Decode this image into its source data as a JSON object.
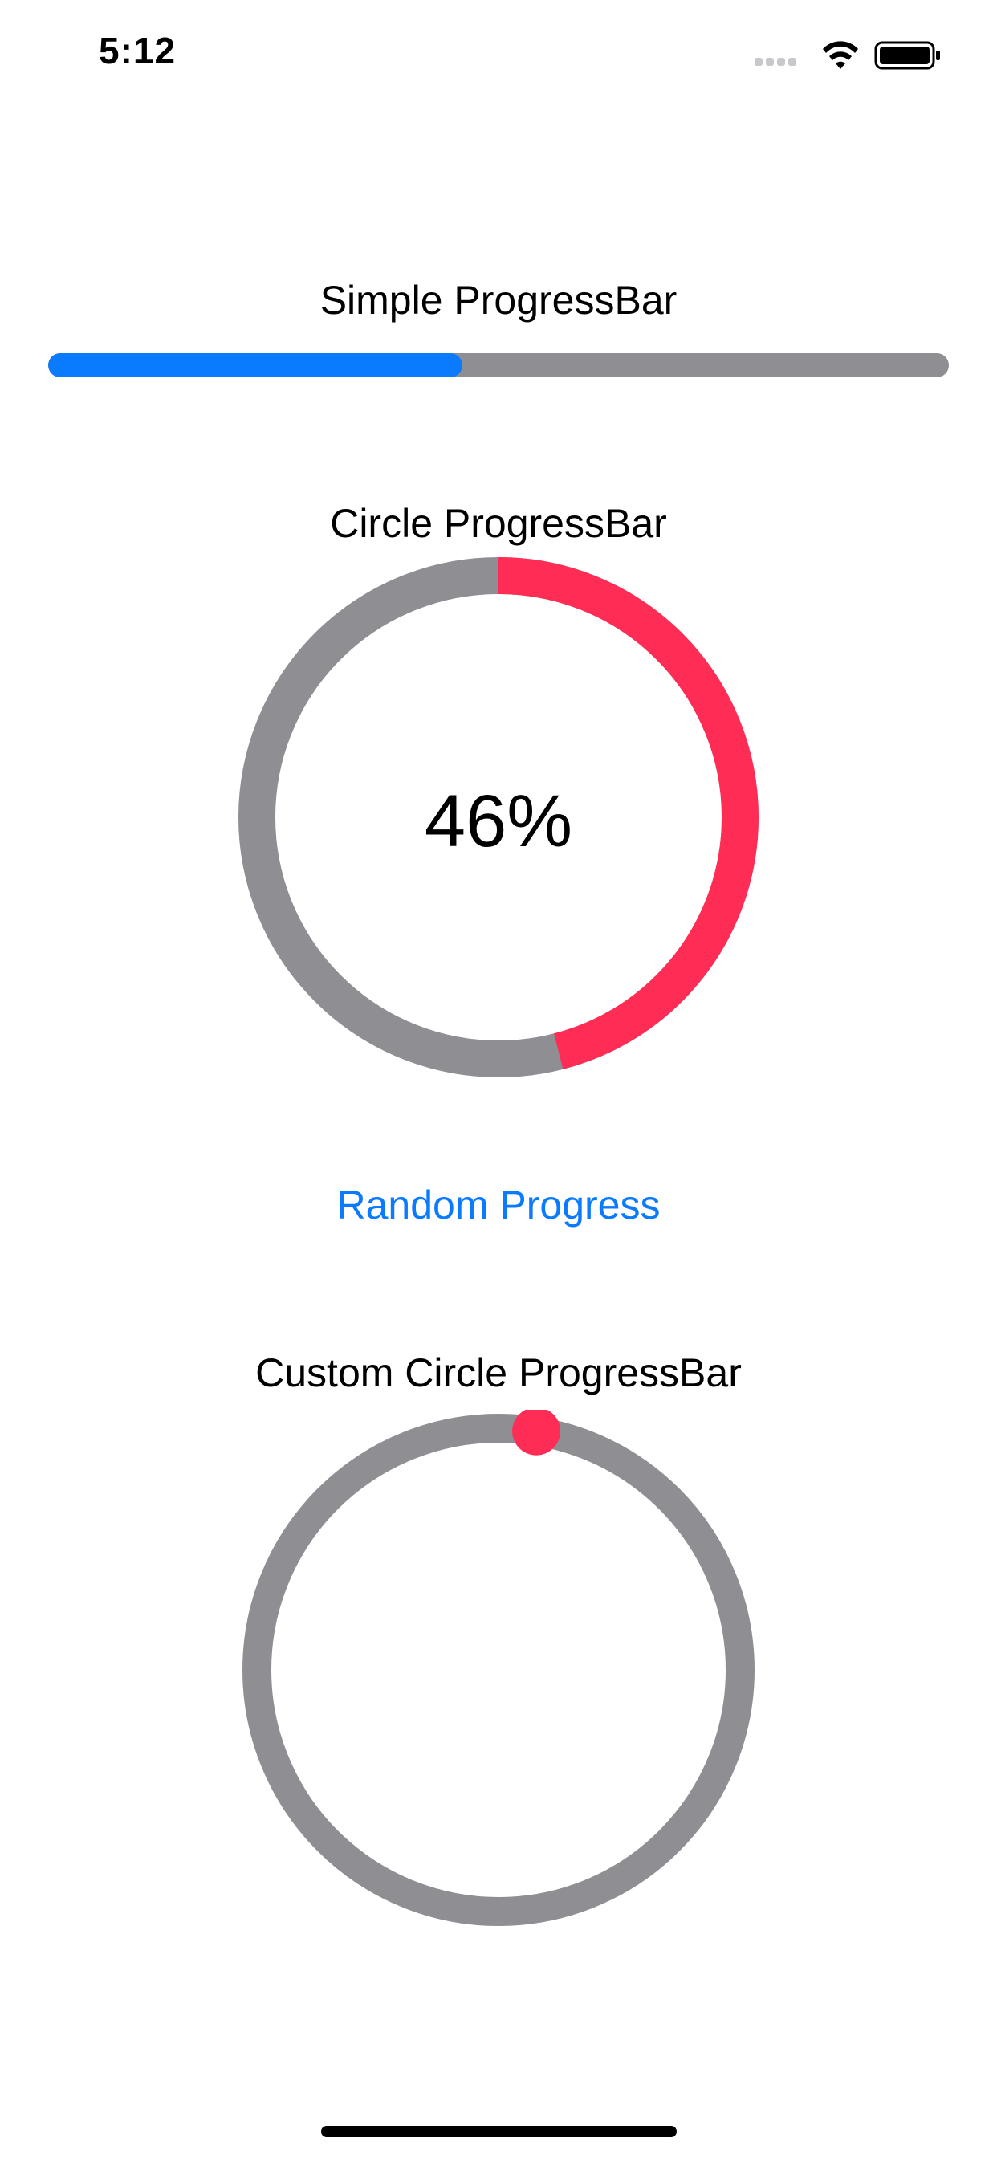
{
  "status_bar": {
    "time": "5:12",
    "icons": [
      "signal-icon",
      "wifi-icon",
      "battery-icon"
    ]
  },
  "simple_progress": {
    "label": "Simple ProgressBar",
    "value": 0.46
  },
  "circle_progress": {
    "label": "Circle ProgressBar",
    "value": 0.46,
    "percent_text": "46%"
  },
  "random_button": {
    "label": "Random Progress"
  },
  "custom_circle_progress": {
    "label": "Custom Circle ProgressBar",
    "value": 0.025
  },
  "colors": {
    "accent_blue": "#0A7AFF",
    "progress_red": "#FF2D55",
    "track_gray": "#8E8E93",
    "text": "#000000",
    "background": "#FFFFFF"
  }
}
